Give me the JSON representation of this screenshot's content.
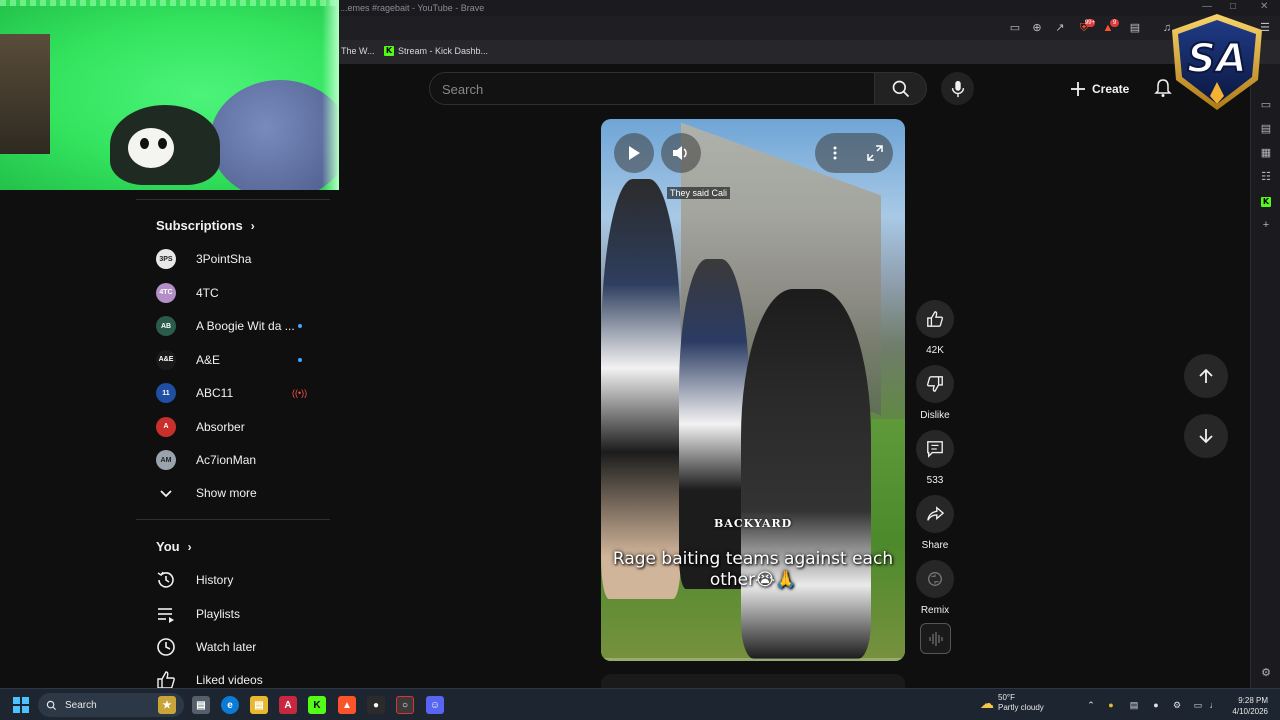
{
  "browser": {
    "window_title": "...emes #ragebait - YouTube - Brave",
    "bookmarks": [
      {
        "label": "The W..."
      },
      {
        "label": "Stream - Kick Dashb..."
      }
    ],
    "shields_badge": "99+",
    "rewards_badge": "9"
  },
  "youtube": {
    "search_placeholder": "Search",
    "create_label": "Create",
    "subscriptions_title": "Subscriptions",
    "subscriptions": [
      {
        "name": "3PointSha",
        "avatar_color": "#e8e8e8",
        "avatar_text": "3PS",
        "indicator": ""
      },
      {
        "name": "4TC",
        "avatar_color": "#b28fc6",
        "avatar_text": "4TC",
        "indicator": ""
      },
      {
        "name": "A Boogie Wit da ...",
        "avatar_color": "#2b5b4a",
        "avatar_text": "AB",
        "indicator": "dot"
      },
      {
        "name": "A&E",
        "avatar_color": "#1a1a1a",
        "avatar_text": "A&E",
        "indicator": "dot"
      },
      {
        "name": "ABC11",
        "avatar_color": "#1e4fa3",
        "avatar_text": "11",
        "indicator": "live"
      },
      {
        "name": "Absorber",
        "avatar_color": "#c9302c",
        "avatar_text": "A",
        "indicator": ""
      },
      {
        "name": "Ac7ionMan",
        "avatar_color": "#9aa3ad",
        "avatar_text": "AM",
        "indicator": ""
      }
    ],
    "show_more_label": "Show more",
    "you_title": "You",
    "you_items": [
      {
        "label": "History",
        "icon": "history-icon"
      },
      {
        "label": "Playlists",
        "icon": "playlists-icon"
      },
      {
        "label": "Watch later",
        "icon": "watch-later-icon"
      },
      {
        "label": "Liked videos",
        "icon": "liked-videos-icon"
      }
    ],
    "short": {
      "overlay_text_top": "They said Cali",
      "overlay_brand": "BACKYARD",
      "caption": "Rage baiting teams against each other😭🙏",
      "likes": "42K",
      "dislike_label": "Dislike",
      "comments": "533",
      "share_label": "Share",
      "remix_label": "Remix"
    }
  },
  "taskbar": {
    "search_label": "Search",
    "weather_temp": "50°F",
    "weather_desc": "Partly cloudy",
    "time": "9:28 PM",
    "date": "4/10/2026"
  },
  "stream_logo": {
    "text": "SA"
  },
  "colors": {
    "youtube_bg": "#0f0f0f",
    "accent_blue": "#3ea6ff",
    "kick_green": "#53fc18",
    "webcam_green": "#33e35e"
  }
}
